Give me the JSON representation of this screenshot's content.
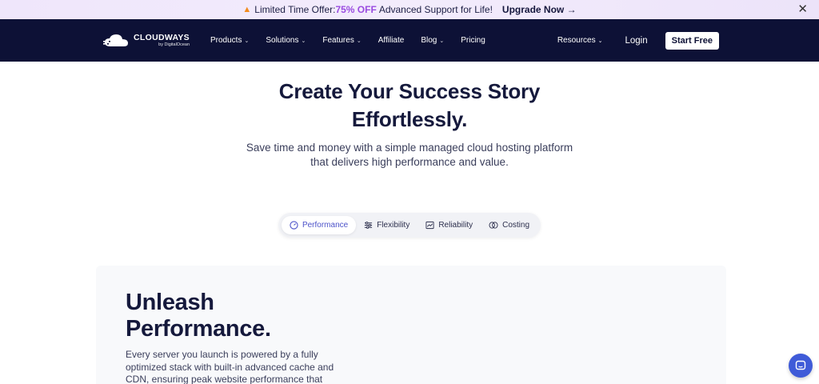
{
  "promo": {
    "prefix": "Limited Time Offer:",
    "highlight": "75% OFF",
    "suffix": "Advanced Support for Life!",
    "cta": "Upgrade Now",
    "cta_arrow": "→",
    "close": "✕"
  },
  "nav": {
    "logo_brand": "CLOUDWAYS",
    "logo_by": "by DigitalOcean",
    "items": [
      {
        "label": "Products",
        "dropdown": "⌄"
      },
      {
        "label": "Solutions",
        "dropdown": "⌄"
      },
      {
        "label": "Features",
        "dropdown": "⌄"
      },
      {
        "label": "Affiliate",
        "dropdown": ""
      },
      {
        "label": "Blog",
        "dropdown": "⌄"
      },
      {
        "label": "Pricing",
        "dropdown": ""
      }
    ],
    "resources": "Resources",
    "resources_chev": "⌄",
    "login": "Login",
    "start": "Start Free"
  },
  "hero": {
    "title_line1": "Create Your Success Story",
    "title_line2": "Effortlessly.",
    "subtitle_line1": "Save time and money with a simple managed cloud hosting platform",
    "subtitle_line2": "that delivers high performance and value."
  },
  "tabs": [
    {
      "label": "Performance",
      "icon": "speedometer-icon",
      "active": true
    },
    {
      "label": "Flexibility",
      "icon": "sliders-icon",
      "active": false
    },
    {
      "label": "Reliability",
      "icon": "chart-icon",
      "active": false
    },
    {
      "label": "Costing",
      "icon": "coins-icon",
      "active": false
    }
  ],
  "section": {
    "title_line1": "Unleash",
    "title_line2": "Performance.",
    "description": "Every server you launch is powered by a fully optimized stack with built-in advanced cache and CDN, ensuring peak website performance that"
  },
  "colors": {
    "nav_bg": "#0d1136",
    "accent": "#4c52c9",
    "promo_highlight": "#9a4ce0",
    "chat_button": "#3f5bd8"
  }
}
